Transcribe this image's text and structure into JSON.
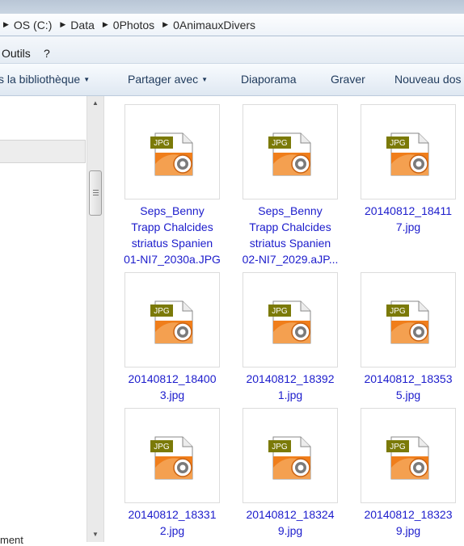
{
  "breadcrumb": [
    "OS (C:)",
    "Data",
    "0Photos",
    "0AnimauxDivers"
  ],
  "menu": {
    "tools": "Outils",
    "help": "?"
  },
  "toolbar": {
    "library": "s la bibliothèque",
    "share": "Partager avec",
    "slideshow": "Diaporama",
    "burn": "Graver",
    "new_folder": "Nouveau dos"
  },
  "nav": {
    "partial_item": "ment"
  },
  "icon": {
    "type_label": "JPG",
    "name": "jpg-file-icon"
  },
  "colors": {
    "link_text": "#1c1ccc",
    "icon_orange": "#f07e1b",
    "icon_tag": "#7b7a08"
  },
  "files": [
    {
      "name": "Seps_Benny Trapp Chalcides striatus Spanien 01-NI7_2030a.JPG",
      "lines": [
        "Seps_Benny",
        "Trapp Chalcides",
        "striatus Spanien",
        "01-NI7_2030a.JPG"
      ]
    },
    {
      "name": "Seps_Benny Trapp Chalcides striatus Spanien 02-NI7_2029.aJP...",
      "lines": [
        "Seps_Benny",
        "Trapp Chalcides",
        "striatus Spanien",
        "02-NI7_2029.aJP..."
      ]
    },
    {
      "name": "20140812_184117.jpg",
      "lines": [
        "20140812_18411",
        "7.jpg"
      ]
    },
    {
      "name": "20140812_184003.jpg",
      "lines": [
        "20140812_18400",
        "3.jpg"
      ]
    },
    {
      "name": "20140812_183921.jpg",
      "lines": [
        "20140812_18392",
        "1.jpg"
      ]
    },
    {
      "name": "20140812_183535.jpg",
      "lines": [
        "20140812_18353",
        "5.jpg"
      ]
    },
    {
      "name": "20140812_183312.jpg",
      "lines": [
        "20140812_18331",
        "2.jpg"
      ]
    },
    {
      "name": "20140812_183249.jpg",
      "lines": [
        "20140812_18324",
        "9.jpg"
      ]
    },
    {
      "name": "20140812_183239.jpg",
      "lines": [
        "20140812_18323",
        "9.jpg"
      ]
    }
  ]
}
